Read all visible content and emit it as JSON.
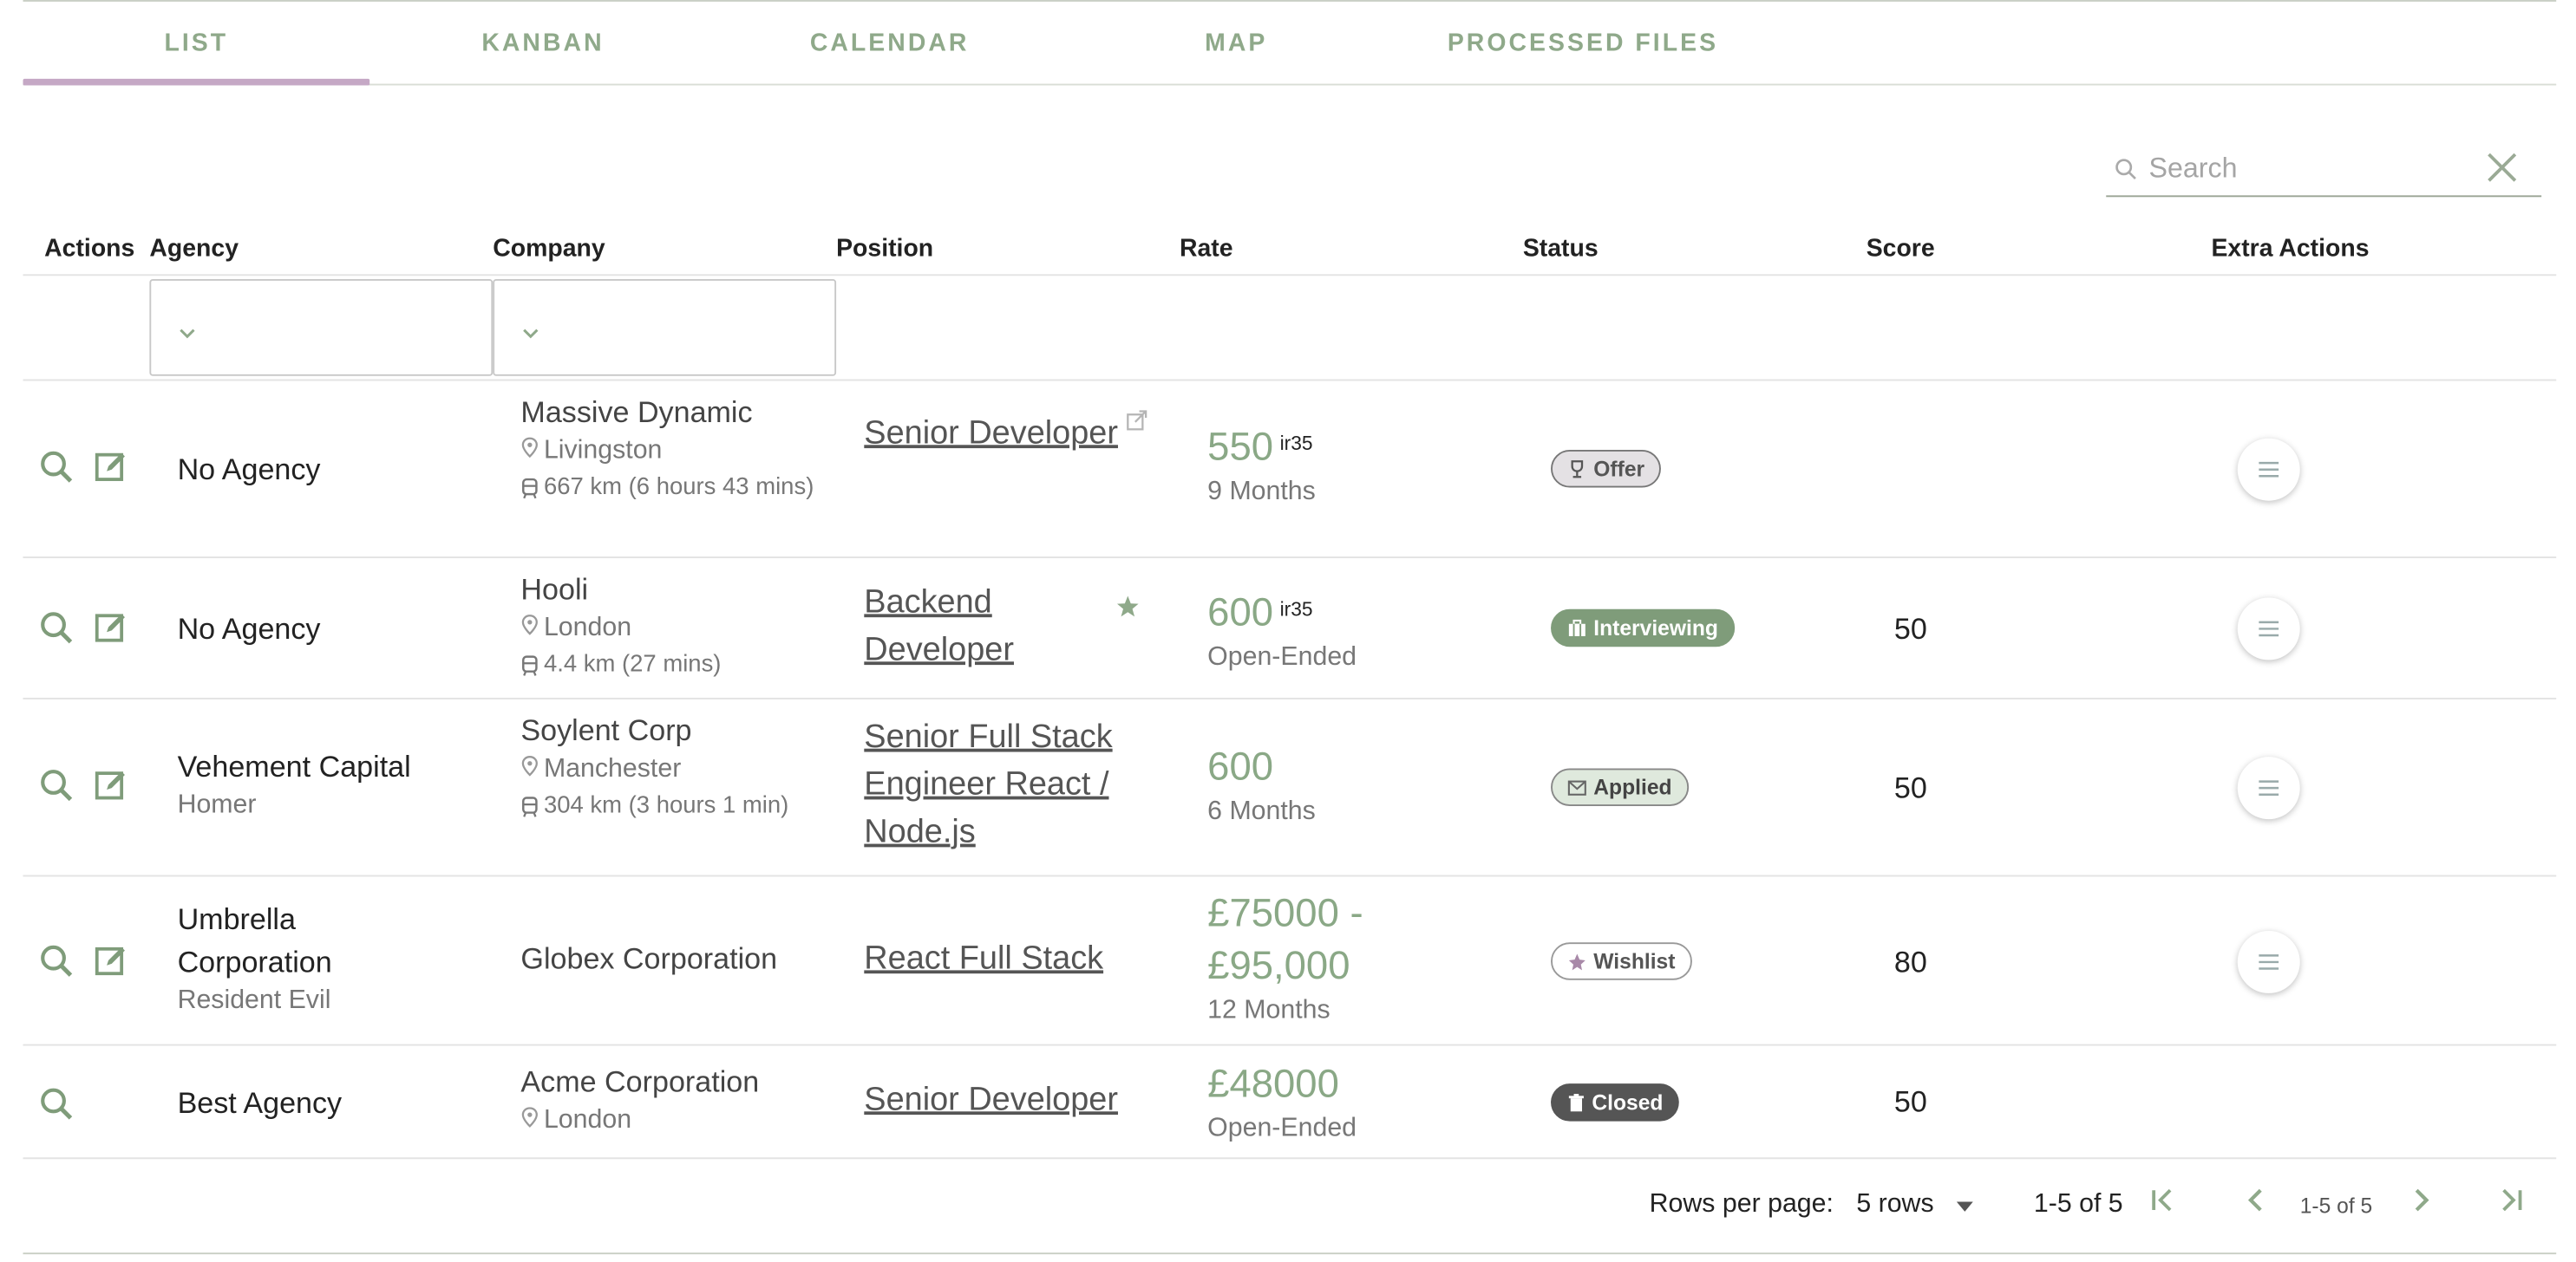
{
  "tabs": [
    {
      "label": "LIST",
      "active": true
    },
    {
      "label": "KANBAN",
      "active": false
    },
    {
      "label": "CALENDAR",
      "active": false
    },
    {
      "label": "MAP",
      "active": false
    },
    {
      "label": "PROCESSED FILES",
      "active": false
    }
  ],
  "search": {
    "placeholder": "Search",
    "value": ""
  },
  "columns": [
    "Actions",
    "Agency",
    "Company",
    "Position",
    "Rate",
    "Status",
    "Score",
    "Extra Actions"
  ],
  "filters": {
    "agency": "",
    "company": ""
  },
  "rows": [
    {
      "agency": "No Agency",
      "agency_sub": "",
      "company": "Massive Dynamic",
      "location": "Livingston",
      "distance": "667 km (6 hours 43 mins)",
      "position": "Senior Developer",
      "position_icon": "external-link-icon",
      "rate": "550",
      "rate_tag": "ir35",
      "duration": "9 Months",
      "status": "Offer",
      "status_icon": "trophy-icon",
      "score": "",
      "has_edit": true,
      "has_menu": true
    },
    {
      "agency": "No Agency",
      "agency_sub": "",
      "company": "Hooli",
      "location": "London",
      "distance": "4.4 km (27 mins)",
      "position": "Backend Developer",
      "position_icon": "star-icon",
      "rate": "600",
      "rate_tag": "ir35",
      "duration": "Open-Ended",
      "status": "Interviewing",
      "status_icon": "briefcase-icon",
      "score": "50",
      "has_edit": true,
      "has_menu": true
    },
    {
      "agency": "Vehement Capital",
      "agency_sub": "Homer",
      "company": "Soylent Corp",
      "location": "Manchester",
      "distance": "304 km (3 hours 1 min)",
      "position": "Senior Full Stack Engineer React / Node.js",
      "position_icon": "",
      "rate": "600",
      "rate_tag": "",
      "duration": "6 Months",
      "status": "Applied",
      "status_icon": "envelope-icon",
      "score": "50",
      "has_edit": true,
      "has_menu": true
    },
    {
      "agency": "Umbrella Corporation",
      "agency_sub": "Resident Evil",
      "company": "Globex Corporation",
      "location": "",
      "distance": "",
      "position": "React Full Stack",
      "position_icon": "",
      "rate": "£75000 - £95,000",
      "rate_tag": "",
      "duration": "12 Months",
      "status": "Wishlist",
      "status_icon": "pin-icon",
      "score": "80",
      "has_edit": true,
      "has_menu": true
    },
    {
      "agency": "Best Agency",
      "agency_sub": "",
      "company": "Acme Corporation",
      "location": "London",
      "distance": "",
      "position": "Senior Developer",
      "position_icon": "",
      "rate": "£48000",
      "rate_tag": "",
      "duration": "Open-Ended",
      "status": "Closed",
      "status_icon": "trash-icon",
      "score": "50",
      "has_edit": false,
      "has_menu": false
    }
  ],
  "pagination": {
    "rows_per_page_label": "Rows per page:",
    "rows_per_page_value": "5 rows",
    "range_label": "1-5 of 5",
    "range_small": "1-5 of 5"
  },
  "colors": {
    "accent": "#8fa98a",
    "tab_indicator": "#c5a8c5",
    "rate": "#8aa886"
  }
}
